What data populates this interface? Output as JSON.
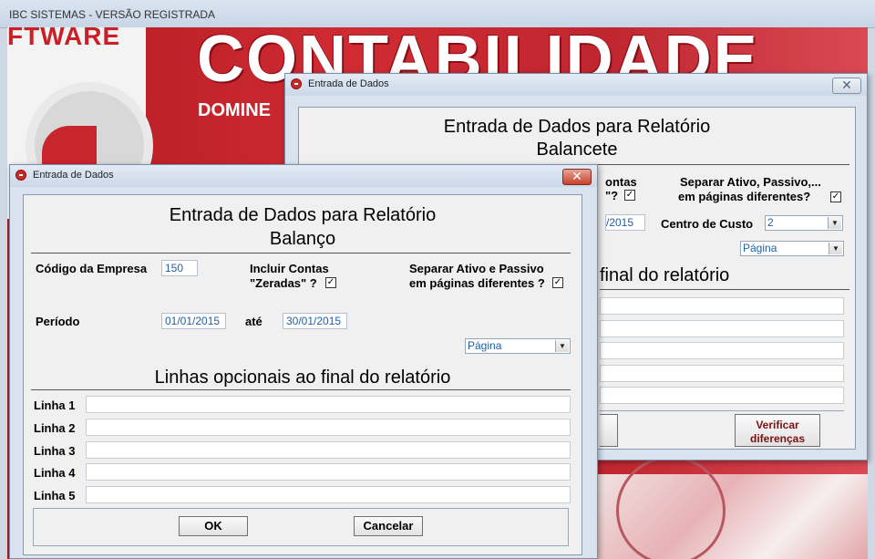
{
  "app": {
    "title": "IBC SISTEMAS - VERSÃO REGISTRADA",
    "banner_left": "FTWARE",
    "banner_title": "CONTABILIDADE",
    "banner_sub": "DOMINE"
  },
  "dialog_back": {
    "title": "Entrada de Dados",
    "close": "✕",
    "heading1": "Entrada de Dados para Relatório",
    "heading2": "Balancete",
    "include_partial_1": "ontas",
    "include_partial_2": "\"?",
    "separate_label_1": "Separar Ativo, Passivo,...",
    "separate_label_2": "em páginas diferentes?",
    "date_partial": "/2015",
    "centro_custo_label": "Centro de Custo",
    "centro_custo_value": "2",
    "pagina_value": "Página",
    "lines_partial": "final do relatório",
    "verificar_label_1": "Verificar",
    "verificar_label_2": "diferenças"
  },
  "dialog_front": {
    "title": "Entrada de Dados",
    "close": "✕",
    "heading1": "Entrada de Dados para Relatório",
    "heading2": "Balanço",
    "codigo_label": "Código da Empresa",
    "codigo_value": "150",
    "incluir_label_1": "Incluir Contas",
    "incluir_label_2": "\"Zeradas\" ?",
    "separar_label_1": "Separar Ativo e Passivo",
    "separar_label_2": "em páginas diferentes ?",
    "periodo_label": "Período",
    "date_from": "01/01/2015",
    "ate_label": "até",
    "date_to": "30/01/2015",
    "pagina_value": "Página",
    "lines_heading": "Linhas opcionais ao final do relatório",
    "lines": [
      "Linha 1",
      "Linha 2",
      "Linha 3",
      "Linha 4",
      "Linha 5"
    ],
    "ok_label": "OK",
    "cancel_label": "Cancelar"
  },
  "icons": {
    "checked": "check-icon",
    "close": "close-icon",
    "dropdown": "chevron-down-icon"
  },
  "colors": {
    "accent_red": "#c91f27",
    "field_text": "#1f5fa8",
    "dialog_bg": "#d8e3ef"
  }
}
